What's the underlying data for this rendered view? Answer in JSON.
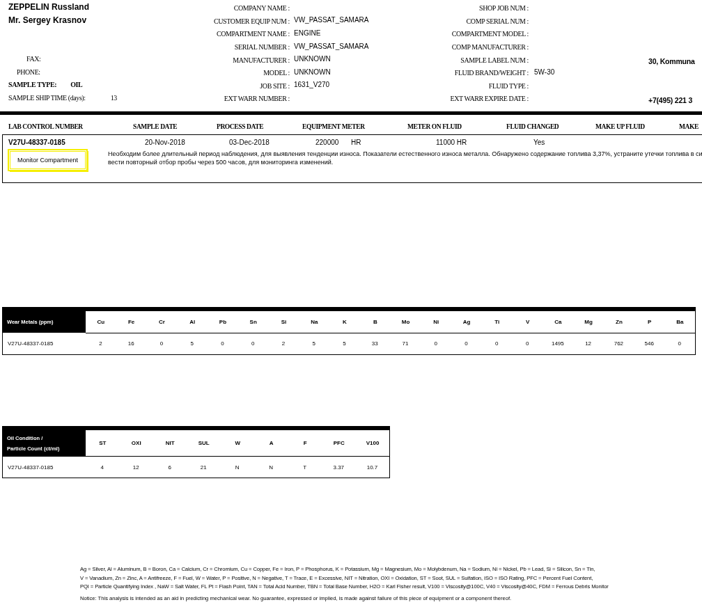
{
  "header": {
    "left": [
      {
        "kind": "company",
        "text": "ZEPPELIN Russland"
      },
      {
        "kind": "contact",
        "text": "Mr. Sergey Krasnov"
      },
      {
        "kind": "fax",
        "label": "FAX:"
      },
      {
        "kind": "phone",
        "label": "PHONE:"
      },
      {
        "kind": "sample_type",
        "label": "SAMPLE TYPE:",
        "value": "OIL"
      },
      {
        "kind": "ship_time",
        "label": "SAMPLE SHIP TIME  (days):",
        "value": "13"
      }
    ],
    "fields": [
      {
        "label": "COMPANY NAME :"
      },
      {
        "label": "CUSTOMER EQUIP NUM :",
        "value": "VW_PASSAT_SAMARA"
      },
      {
        "label": "COMPARTMENT NAME :",
        "value": "ENGINE"
      },
      {
        "label": "SERIAL NUMBER :",
        "value": "VW_PASSAT_SAMARA"
      },
      {
        "label": "MANUFACTURER :",
        "value": "UNKNOWN"
      },
      {
        "label": "MODEL :",
        "value": "UNKNOWN"
      },
      {
        "label": "JOB SITE :",
        "value": "1631_V270"
      },
      {
        "label": "EXT WARR NUMBER :"
      }
    ],
    "fields_right": [
      {
        "label": "SHOP JOB NUM :"
      },
      {
        "label": "COMP SERIAL NUM :"
      },
      {
        "label": "COMPARTMENT MODEL :"
      },
      {
        "label": "COMP MANUFACTURER :"
      },
      {
        "label": "SAMPLE LABEL NUM :"
      },
      {
        "label": "FLUID BRAND/WEIGHT :",
        "value": "5W-30"
      },
      {
        "label": "FLUID TYPE :"
      },
      {
        "label": "EXT WARR EXPIRE DATE :"
      }
    ],
    "far": [
      {
        "kind": "address",
        "text": "30, Kommuna"
      },
      {
        "kind": "phone",
        "text": "+7(495) 221 3"
      }
    ]
  },
  "lab": {
    "columns": [
      "LAB CONTROL NUMBER",
      "SAMPLE  DATE",
      "PROCESS DATE",
      "EQUIPMENT METER",
      "METER ON FLUID",
      "FLUID CHANGED",
      "MAKE UP FLUID",
      "MAKE"
    ],
    "row": [
      "V27U-48337-0185",
      "20-Nov-2018",
      "03-Dec-2018",
      "220000",
      "HR",
      "11000 HR",
      "Yes"
    ],
    "status": "Monitor Compartment",
    "comment_lines": [
      "Необходим более длительный период наблюдения, для выявления тенденции износа.  Показатели естественного износа металла.  Обнаружено содержание топлива 3,37%, устраните утечки топлива в си",
      "вести повторный отбор пробы через 500 часов, для мониторинга изменений."
    ]
  },
  "wear": {
    "title": "Wear Metals (ppm)",
    "columns": [
      "Cu",
      "Fe",
      "Cr",
      "Al",
      "Pb",
      "Sn",
      "Si",
      "Na",
      "K",
      "B",
      "Mo",
      "Ni",
      "Ag",
      "Ti",
      "V",
      "Ca",
      "Mg",
      "Zn",
      "P",
      "Ba"
    ],
    "rows": [
      {
        "id": "V27U-48337-0185",
        "values": [
          "2",
          "16",
          "0",
          "5",
          "0",
          "0",
          "2",
          "5",
          "5",
          "33",
          "71",
          "0",
          "0",
          "0",
          "0",
          "1495",
          "12",
          "762",
          "546",
          "0"
        ]
      }
    ]
  },
  "oil": {
    "title_lines": [
      "Oil Condition /",
      "Particle Count (ct/ml)"
    ],
    "columns": [
      "ST",
      "OXI",
      "NIT",
      "SUL",
      "W",
      "A",
      "F",
      "PFC",
      "V100"
    ],
    "rows": [
      {
        "id": "V27U-48337-0185",
        "values": [
          "4",
          "12",
          "6",
          "21",
          "N",
          "N",
          "T",
          "3.37",
          "10.7"
        ]
      }
    ]
  },
  "legend_lines": [
    "Ag = Silver, Al = Aluminum, B = Boron, Ca = Calcium, Cr = Chromium, Cu = Copper, Fe = Iron, P = Phosphorus, K = Potassium, Mg = Magnesium,  Mo = Molybdenum, Na = Sodium, Ni = Nickel, Pb = Lead, Si = Silicon, Sn = Tin,",
    "V = Vanadium, Zn = Zinc, A = Antifreeze, F = Fuel, W = Water,  P = Positive, N = Negative, T = Trace, E = Excessive, NIT = Nitration, OXI = Oxidation, ST = Soot, SUL = Sulfation, ISO = ISO Rating, PFC = Percent Fuel Content,",
    "PQI = Particle Quantifying Index , NaW = Salt Water, FL Pt = Flash Point, TAN = Total Acid Number, TBN = Total Base Number, H2O = Karl Fisher result, V100 = Viscosity@100C, V40 = Viscosity@40C, FDM = Ferrous Debris Monitor"
  ],
  "notice": "Notice: This analysis is intended as an aid in predicting mechanical wear.  No guarantee, expressed or implied, is made against failure of this piece of equipment or a component thereof."
}
